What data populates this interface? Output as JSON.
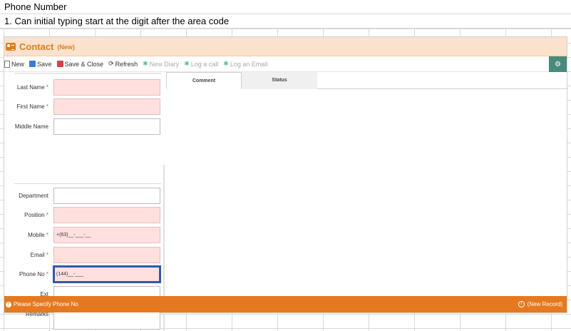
{
  "sheet": {
    "row1": "Phone Number",
    "row2": "1. Can initial typing start at the digit after the area code"
  },
  "form": {
    "title": "Contact",
    "subtitle": "(New)",
    "toolbar": {
      "new": "New",
      "save": "Save",
      "save_close": "Save & Close",
      "refresh": "Refresh",
      "new_diary": "New Diary",
      "log_call": "Log a call",
      "log_email": "Log an Email"
    },
    "fields": {
      "last_name": {
        "label": "Last Name",
        "value": ""
      },
      "first_name": {
        "label": "First Name",
        "value": ""
      },
      "middle_name": {
        "label": "Middle Name",
        "value": ""
      },
      "department": {
        "label": "Department",
        "value": ""
      },
      "position": {
        "label": "Position",
        "value": ""
      },
      "mobile": {
        "label": "Mobile",
        "value": "+(63)__-___-__"
      },
      "email": {
        "label": "Email",
        "value": ""
      },
      "phone": {
        "label": "Phone No",
        "value": "(144)__-___"
      },
      "ext": {
        "label": "Ext",
        "value": ""
      },
      "remarks": {
        "label": "Remarks",
        "value": ""
      }
    },
    "required_mark": "*",
    "tabs": [
      "Comment",
      "Status"
    ],
    "status": {
      "message": "Please Specify Phone No",
      "record": "(New Record)"
    }
  },
  "colors": {
    "accent": "#e07d22",
    "status_bar": "#e5791f",
    "required_bg": "#ffe0df",
    "focus_border": "#2f5aa8"
  }
}
